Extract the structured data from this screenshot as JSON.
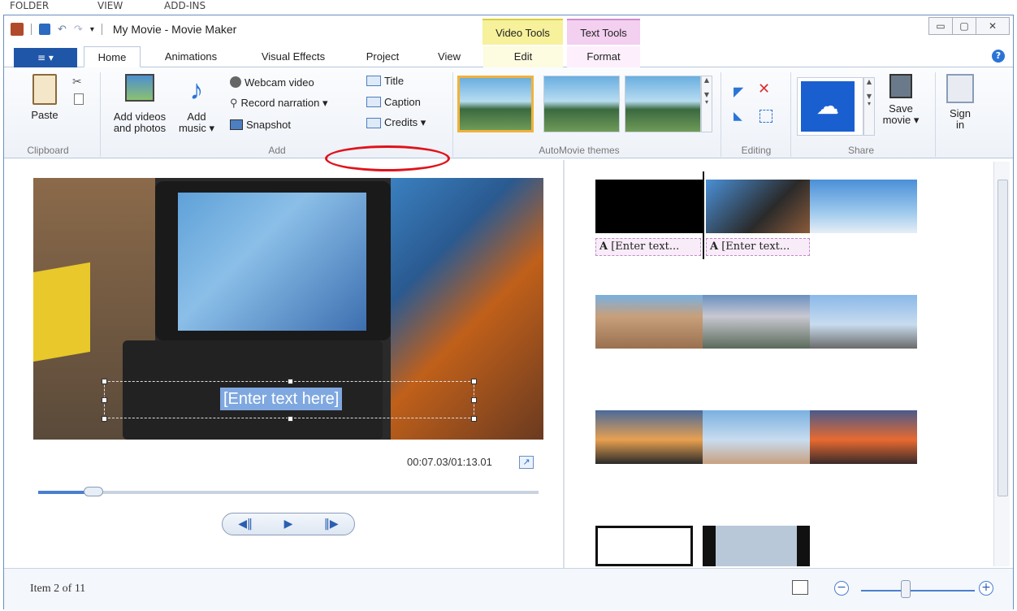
{
  "bg_menu": [
    "FOLDER",
    "VIEW",
    "ADD-INS"
  ],
  "titlebar": {
    "title": "My Movie - Movie Maker",
    "ctx_video": "Video Tools",
    "ctx_text": "Text Tools",
    "min": "▭",
    "max": "▢",
    "close": "✕"
  },
  "tabs": {
    "file": "≡ ▾",
    "home": "Home",
    "animations": "Animations",
    "visual_effects": "Visual Effects",
    "project": "Project",
    "view": "View",
    "edit": "Edit",
    "format": "Format",
    "help": "?"
  },
  "ribbon": {
    "paste": "Paste",
    "clipboard": "Clipboard",
    "add_videos": "Add videos",
    "and_photos": "and photos",
    "add": "Add",
    "music": "music ▾",
    "webcam": "Webcam video",
    "record_narration": "Record narration ▾",
    "snapshot": "Snapshot",
    "title_btn": "Title",
    "caption": "Caption",
    "credits": "Credits ▾",
    "add_group": "Add",
    "themes_group": "AutoMovie themes",
    "editing_group": "Editing",
    "save": "Save",
    "movie": "movie ▾",
    "share_group": "Share",
    "sign": "Sign",
    "in": "in"
  },
  "preview": {
    "caption_text": "[Enter text here]",
    "timecode": "00:07.03/01:13.01",
    "fullscreen": "↗",
    "prev_frame": "◀‖",
    "play": "▶",
    "next_frame": "‖▶"
  },
  "storyboard": {
    "caption1": "[Enter text...",
    "caption2": "[Enter text...",
    "caption_icon": "A"
  },
  "status": {
    "item_text": "Item 2 of 11",
    "zoom_out": "−",
    "zoom_in": "+"
  },
  "colors": {
    "accent_blue": "#1f56a8",
    "ctx_video": "#f6f19a",
    "ctx_text": "#f3cff0",
    "annotation_red": "#e1121a"
  }
}
